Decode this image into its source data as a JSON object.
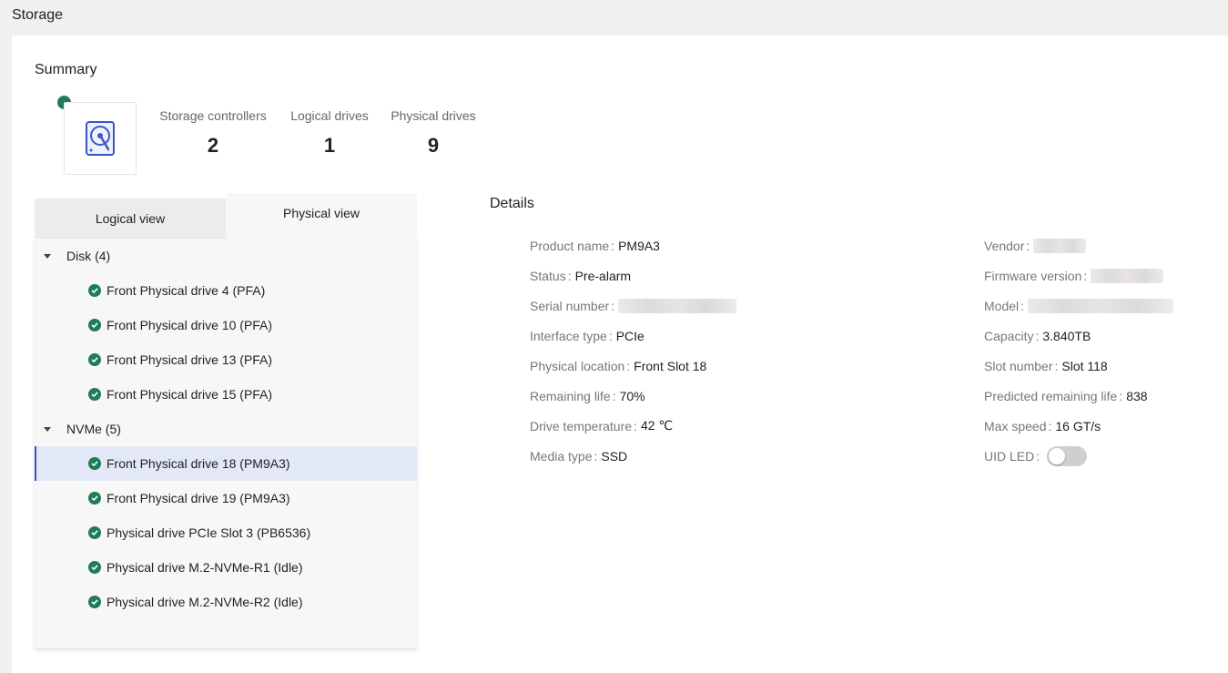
{
  "page": {
    "title": "Storage"
  },
  "summary": {
    "title": "Summary",
    "icon": "hard-disk-icon",
    "status_color": "#1e7d56",
    "stats": [
      {
        "label": "Storage controllers",
        "value": "2"
      },
      {
        "label": "Logical drives",
        "value": "1"
      },
      {
        "label": "Physical drives",
        "value": "9"
      }
    ]
  },
  "tabs": [
    {
      "label": "Logical view",
      "active": false
    },
    {
      "label": "Physical view",
      "active": true
    }
  ],
  "tree": {
    "groups": [
      {
        "label": "Disk (4)",
        "items": [
          "Front Physical drive 4 (PFA)",
          "Front Physical drive 10 (PFA)",
          "Front Physical drive 13 (PFA)",
          "Front Physical drive 15 (PFA)"
        ]
      },
      {
        "label": "NVMe (5)",
        "items": [
          "Front Physical drive 18 (PM9A3)",
          "Front Physical drive 19 (PM9A3)",
          "Physical drive PCIe Slot 3 (PB6536)",
          "Physical drive M.2-NVMe-R1 (Idle)",
          "Physical drive M.2-NVMe-R2 (Idle)"
        ]
      }
    ],
    "selected": "Front Physical drive 18 (PM9A3)"
  },
  "details": {
    "title": "Details",
    "left": [
      {
        "key": "Product name",
        "value": "PM9A3"
      },
      {
        "key": "Status",
        "value": "Pre-alarm"
      },
      {
        "key": "Serial number",
        "value": ""
      },
      {
        "key": "Interface type",
        "value": "PCIe"
      },
      {
        "key": "Physical location",
        "value": "Front Slot 18"
      },
      {
        "key": "Remaining life",
        "value": "70%"
      },
      {
        "key": "Drive temperature",
        "value": "42 ℃"
      },
      {
        "key": "Media type",
        "value": "SSD"
      }
    ],
    "right": [
      {
        "key": "Vendor",
        "value": ""
      },
      {
        "key": "Firmware version",
        "value": ""
      },
      {
        "key": "Model",
        "value": ""
      },
      {
        "key": "Capacity",
        "value": "3.840TB"
      },
      {
        "key": "Slot number",
        "value": "Slot 118"
      },
      {
        "key": "Predicted remaining life",
        "value": "838"
      },
      {
        "key": "Max speed",
        "value": "16 GT/s"
      },
      {
        "key": "UID LED",
        "value": ""
      }
    ],
    "uid_led_on": false
  }
}
